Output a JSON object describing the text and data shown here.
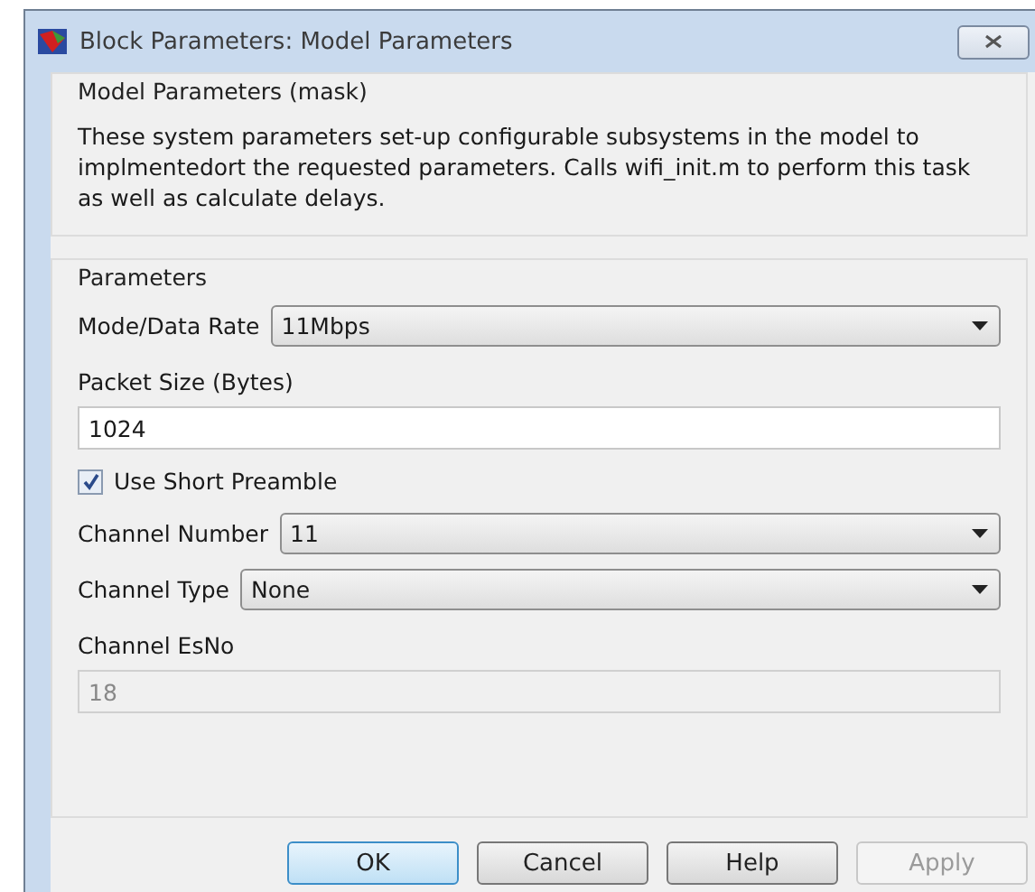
{
  "window": {
    "title": "Block Parameters: Model Parameters"
  },
  "mask": {
    "title": "Model Parameters (mask)",
    "description": "These system parameters set-up configurable subsystems in the model to implmentedort the requested parameters. Calls wifi_init.m to perform this task as well as calculate delays."
  },
  "parameters": {
    "title": "Parameters",
    "items": [
      {
        "kind": "dropdown",
        "label": "Mode/Data Rate",
        "value": "11Mbps"
      },
      {
        "kind": "field",
        "label": "Packet Size (Bytes)",
        "value": "1024",
        "disabled": false
      },
      {
        "kind": "checkbox",
        "label": "Use Short Preamble",
        "checked": true
      },
      {
        "kind": "dropdown",
        "label": "Channel Number",
        "value": "11"
      },
      {
        "kind": "dropdown",
        "label": "Channel Type",
        "value": "None"
      },
      {
        "kind": "field",
        "label": "Channel EsNo",
        "value": "18",
        "disabled": true
      }
    ]
  },
  "buttons": [
    {
      "label": "OK",
      "default": true,
      "disabled": false
    },
    {
      "label": "Cancel",
      "default": false,
      "disabled": false
    },
    {
      "label": "Help",
      "default": false,
      "disabled": false
    },
    {
      "label": "Apply",
      "default": false,
      "disabled": true
    }
  ]
}
